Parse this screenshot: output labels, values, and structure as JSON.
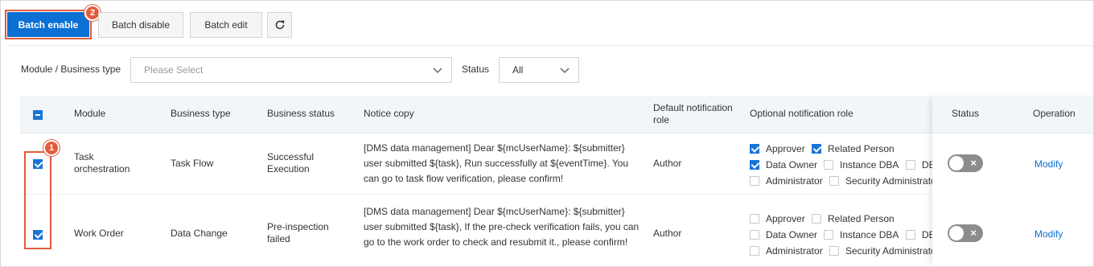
{
  "toolbar": {
    "batch_enable": "Batch enable",
    "batch_disable": "Batch disable",
    "batch_edit": "Batch edit",
    "refresh_icon": "refresh-icon",
    "badge_2": "2",
    "accent": "#0b6fd3",
    "highlight": "#e15b3d"
  },
  "filters": {
    "module_label": "Module / Business type",
    "module_placeholder": "Please Select",
    "status_label": "Status",
    "status_value": "All"
  },
  "table": {
    "columns": {
      "module": "Module",
      "business_type": "Business type",
      "business_status": "Business status",
      "notice_copy": "Notice copy",
      "default_role": "Default notification role",
      "optional_role": "Optional notification role",
      "status": "Status",
      "operation": "Operation"
    },
    "badge_1": "1",
    "rows": [
      {
        "selected": true,
        "module": "Task orchestration",
        "business_type": "Task Flow",
        "business_status": "Successful Execution",
        "notice": "[DMS data management] Dear ${mcUserName}: ${submitter} user submitted ${task}, Run successfully at ${eventTime}. You can go to task flow verification, please confirm!",
        "default_role": "Author",
        "roles": {
          "approver": {
            "label": "Approver",
            "checked": true
          },
          "related_person": {
            "label": "Related Person",
            "checked": true
          },
          "data_owner": {
            "label": "Data Owner",
            "checked": true
          },
          "instance_dba": {
            "label": "Instance DBA",
            "checked": false
          },
          "dba": {
            "label": "DB",
            "checked": false
          },
          "administrator": {
            "label": "Administrator",
            "checked": false
          },
          "security_admin": {
            "label": "Security Administrator",
            "checked": false
          }
        },
        "status_on": false,
        "operation": "Modify"
      },
      {
        "selected": true,
        "module": "Work Order",
        "business_type": "Data Change",
        "business_status": "Pre-inspection failed",
        "notice": "[DMS data management] Dear ${mcUserName}: ${submitter} user submitted ${task}, If the pre-check verification fails, you can go to the work order to check and resubmit it., please confirm!",
        "default_role": "Author",
        "roles": {
          "approver": {
            "label": "Approver",
            "checked": false
          },
          "related_person": {
            "label": "Related Person",
            "checked": false
          },
          "data_owner": {
            "label": "Data Owner",
            "checked": false
          },
          "instance_dba": {
            "label": "Instance DBA",
            "checked": false
          },
          "dba": {
            "label": "DB",
            "checked": false
          },
          "administrator": {
            "label": "Administrator",
            "checked": false
          },
          "security_admin": {
            "label": "Security Administrator",
            "checked": false
          }
        },
        "status_on": false,
        "operation": "Modify"
      }
    ]
  },
  "switch_off_symbol": "×"
}
